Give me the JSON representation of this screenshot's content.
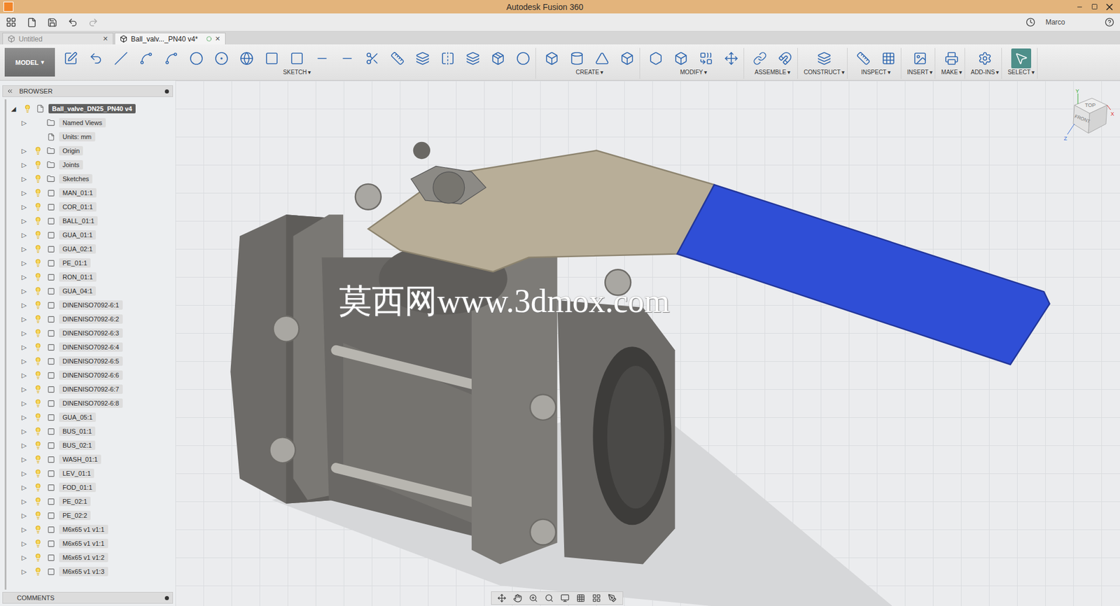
{
  "window": {
    "title": "Autodesk Fusion 360",
    "user": "Marco"
  },
  "tabs": [
    {
      "label": "Untitled",
      "selected": false,
      "close": "✕"
    },
    {
      "label": "Ball_valv..._PN40 v4*",
      "selected": true,
      "close": "✕"
    }
  ],
  "workspace": {
    "label": "MODEL",
    "arrow": "▾"
  },
  "toolbar_groups": [
    {
      "label": "SKETCH",
      "arrow": "▾",
      "selected": false
    },
    {
      "label": "CREATE",
      "arrow": "▾",
      "selected": false
    },
    {
      "label": "MODIFY",
      "arrow": "▾",
      "selected": false
    },
    {
      "label": "ASSEMBLE",
      "arrow": "▾",
      "selected": false
    },
    {
      "label": "CONSTRUCT",
      "arrow": "▾",
      "selected": false
    },
    {
      "label": "INSPECT",
      "arrow": "▾",
      "selected": false
    },
    {
      "label": "INSERT",
      "arrow": "▾",
      "selected": false
    },
    {
      "label": "MAKE",
      "arrow": "▾",
      "selected": false
    },
    {
      "label": "ADD-INS",
      "arrow": "▾",
      "selected": false
    },
    {
      "label": "SELECT",
      "arrow": "▾",
      "selected": true
    }
  ],
  "browser": {
    "title": "BROWSER",
    "root": {
      "label": "Ball_valve_DN25_PN40 v4",
      "expanded": true,
      "selected": true
    },
    "items": [
      {
        "label": "Named Views",
        "kind": "folder",
        "expandable": true,
        "has_bulb": false
      },
      {
        "label": "Units: mm",
        "kind": "units",
        "expandable": false,
        "has_bulb": false
      },
      {
        "label": "Origin",
        "kind": "folder",
        "expandable": true,
        "has_bulb": true
      },
      {
        "label": "Joints",
        "kind": "folder",
        "expandable": true,
        "has_bulb": true
      },
      {
        "label": "Sketches",
        "kind": "folder",
        "expandable": true,
        "has_bulb": true
      },
      {
        "label": "MAN_01:1",
        "kind": "component",
        "expandable": true,
        "has_bulb": true
      },
      {
        "label": "COR_01:1",
        "kind": "component",
        "expandable": true,
        "has_bulb": true
      },
      {
        "label": "BALL_01:1",
        "kind": "component",
        "expandable": true,
        "has_bulb": true
      },
      {
        "label": "GUA_01:1",
        "kind": "component",
        "expandable": true,
        "has_bulb": true
      },
      {
        "label": "GUA_02:1",
        "kind": "component",
        "expandable": true,
        "has_bulb": true
      },
      {
        "label": "PE_01:1",
        "kind": "component",
        "expandable": true,
        "has_bulb": true
      },
      {
        "label": "RON_01:1",
        "kind": "component",
        "expandable": true,
        "has_bulb": true
      },
      {
        "label": "GUA_04:1",
        "kind": "component",
        "expandable": true,
        "has_bulb": true
      },
      {
        "label": "DINENISO7092-6:1",
        "kind": "component",
        "expandable": true,
        "has_bulb": true
      },
      {
        "label": "DINENISO7092-6:2",
        "kind": "component",
        "expandable": true,
        "has_bulb": true
      },
      {
        "label": "DINENISO7092-6:3",
        "kind": "component",
        "expandable": true,
        "has_bulb": true
      },
      {
        "label": "DINENISO7092-6:4",
        "kind": "component",
        "expandable": true,
        "has_bulb": true
      },
      {
        "label": "DINENISO7092-6:5",
        "kind": "component",
        "expandable": true,
        "has_bulb": true
      },
      {
        "label": "DINENISO7092-6:6",
        "kind": "component",
        "expandable": true,
        "has_bulb": true
      },
      {
        "label": "DINENISO7092-6:7",
        "kind": "component",
        "expandable": true,
        "has_bulb": true
      },
      {
        "label": "DINENISO7092-6:8",
        "kind": "component",
        "expandable": true,
        "has_bulb": true
      },
      {
        "label": "GUA_05:1",
        "kind": "component",
        "expandable": true,
        "has_bulb": true
      },
      {
        "label": "BUS_01:1",
        "kind": "component",
        "expandable": true,
        "has_bulb": true
      },
      {
        "label": "BUS_02:1",
        "kind": "component",
        "expandable": true,
        "has_bulb": true
      },
      {
        "label": "WASH_01:1",
        "kind": "component",
        "expandable": true,
        "has_bulb": true
      },
      {
        "label": "LEV_01:1",
        "kind": "component",
        "expandable": true,
        "has_bulb": true
      },
      {
        "label": "FOD_01:1",
        "kind": "component",
        "expandable": true,
        "has_bulb": true
      },
      {
        "label": "PE_02:1",
        "kind": "component",
        "expandable": true,
        "has_bulb": true
      },
      {
        "label": "PE_02:2",
        "kind": "component",
        "expandable": true,
        "has_bulb": true
      },
      {
        "label": "M6x65 v1 v1:1",
        "kind": "component",
        "expandable": true,
        "has_bulb": true
      },
      {
        "label": "M6x65 v1 v1:1",
        "kind": "component",
        "expandable": true,
        "has_bulb": true
      },
      {
        "label": "M6x65 v1 v1:2",
        "kind": "component",
        "expandable": true,
        "has_bulb": true
      },
      {
        "label": "M6x65 v1 v1:3",
        "kind": "component",
        "expandable": true,
        "has_bulb": true
      }
    ]
  },
  "comments": {
    "title": "COMMENTS"
  },
  "view_cube": {
    "top": "TOP",
    "front": "FRONT",
    "axes": [
      "X",
      "Y",
      "Z"
    ]
  },
  "watermark": "莫西网www.3dmox.com"
}
